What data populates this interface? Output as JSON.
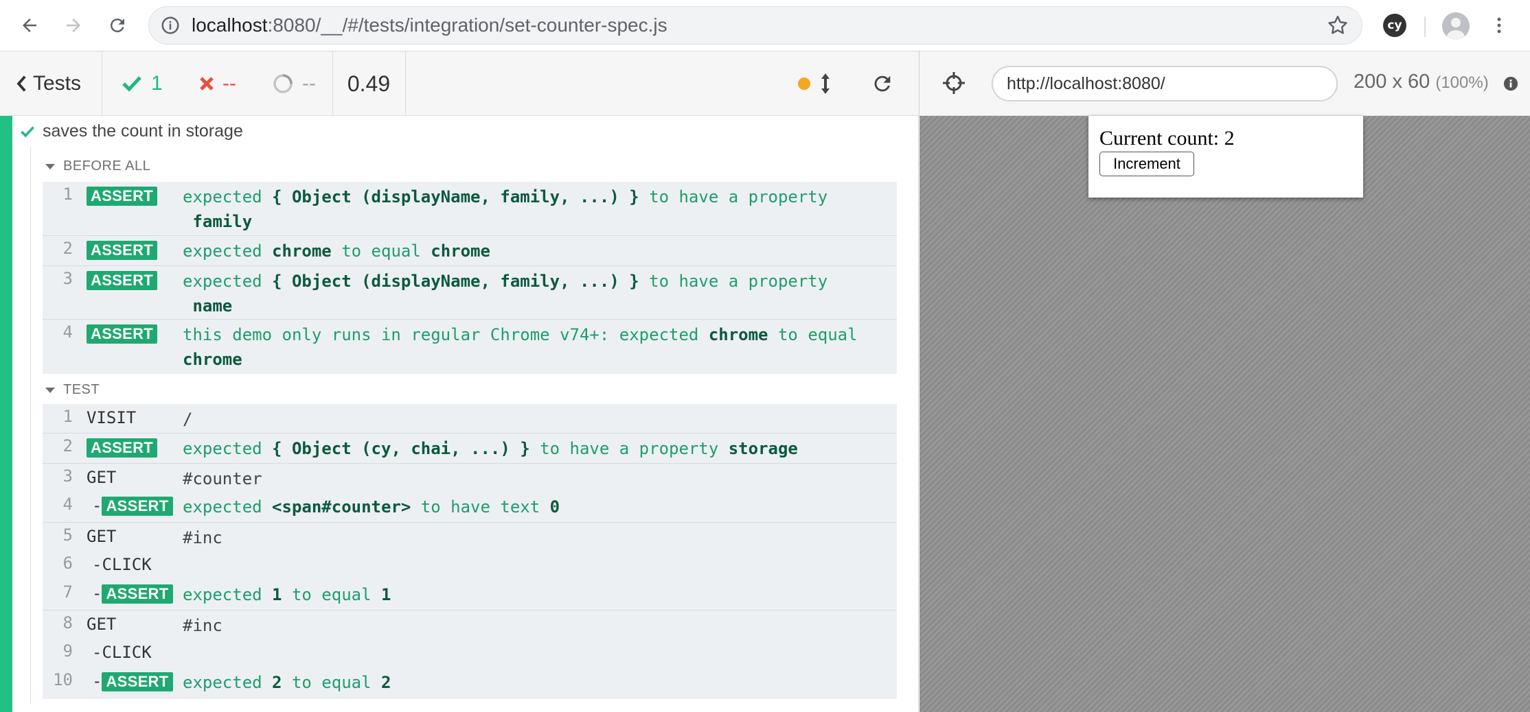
{
  "browser": {
    "url_host": "localhost",
    "url_rest": ":8080/__/#/tests/integration/set-counter-spec.js",
    "extension_label": "cy"
  },
  "reporter": {
    "back_label": "Tests",
    "passed": "1",
    "failed": "--",
    "pending": "--",
    "duration": "0.49",
    "test_title": "saves the count in storage",
    "before_all_label": "BEFORE ALL",
    "test_label": "TEST"
  },
  "runner": {
    "url": "http://localhost:8080/",
    "viewport": "200 x 60",
    "zoom": "(100%)"
  },
  "before_all": [
    {
      "num": "1",
      "badge": "ASSERT",
      "msg": "expected { Object (displayName, family, ...) } to have a property family"
    },
    {
      "num": "2",
      "badge": "ASSERT",
      "msg": "expected chrome to equal chrome"
    },
    {
      "num": "3",
      "badge": "ASSERT",
      "msg": "expected { Object (displayName, family, ...) } to have a property name"
    },
    {
      "num": "4",
      "badge": "ASSERT",
      "msg": "this demo only runs in regular Chrome v74+: expected chrome to equal chrome"
    }
  ],
  "test_cmds": [
    {
      "num": "1",
      "name": "VISIT",
      "msg": "/"
    },
    {
      "num": "2",
      "badge": "ASSERT",
      "msg": "expected { Object (cy, chai, ...) } to have a property storage"
    },
    {
      "num": "3",
      "name": "GET",
      "msg": "#counter"
    },
    {
      "num": "4",
      "child": "-",
      "badge": "ASSERT",
      "msg": "expected <span#counter> to have text 0"
    },
    {
      "num": "5",
      "name": "GET",
      "msg": "#inc"
    },
    {
      "num": "6",
      "child": "-",
      "name": "CLICK",
      "msg": ""
    },
    {
      "num": "7",
      "child": "-",
      "badge": "ASSERT",
      "msg": "expected 1 to equal 1"
    },
    {
      "num": "8",
      "name": "GET",
      "msg": "#inc"
    },
    {
      "num": "9",
      "child": "-",
      "name": "CLICK",
      "msg": ""
    },
    {
      "num": "10",
      "child": "-",
      "badge": "ASSERT",
      "msg": "expected 2 to equal 2"
    }
  ],
  "app": {
    "count_text": "Current count: 2",
    "button_label": "Increment"
  },
  "colors": {
    "pass": "#21c186",
    "fail": "#e94f3f",
    "badge": "#1fa971",
    "running_dot": "#f5a623"
  }
}
